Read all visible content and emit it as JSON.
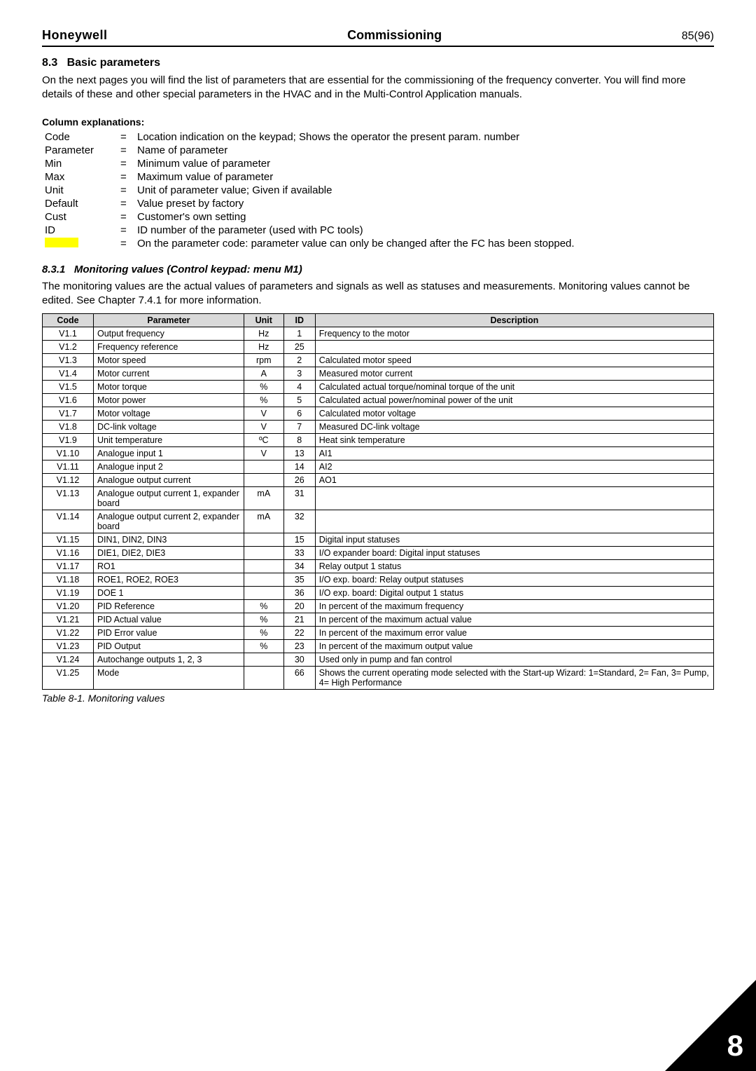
{
  "header": {
    "brand": "Honeywell",
    "title": "Commissioning",
    "page": "85(96)"
  },
  "section": {
    "number": "8.3",
    "title": "Basic parameters",
    "intro": "On the next pages you will find the list of parameters that are essential for the commissioning of the frequency converter. You will find more details of these and other special parameters in the HVAC and in the Multi-Control Application manuals."
  },
  "column_explanations": {
    "heading": "Column explanations:",
    "rows": [
      {
        "label": "Code",
        "desc": "Location indication on the keypad; Shows the operator the present param. number"
      },
      {
        "label": "Parameter",
        "desc": "Name of parameter"
      },
      {
        "label": "Min",
        "desc": "Minimum value of parameter"
      },
      {
        "label": "Max",
        "desc": "Maximum value of parameter"
      },
      {
        "label": "Unit",
        "desc": "Unit of parameter value; Given if available"
      },
      {
        "label": "Default",
        "desc": "Value preset by factory"
      },
      {
        "label": "Cust",
        "desc": "Customer's own setting"
      },
      {
        "label": "ID",
        "desc": "ID number of the parameter (used with PC tools)"
      },
      {
        "label": "__YELLOW__",
        "desc": "On the parameter code: parameter value can only be changed after the FC has been stopped."
      }
    ]
  },
  "subsection": {
    "number": "8.3.1",
    "title": "Monitoring values (Control keypad: menu M1)",
    "intro": "The monitoring values are the actual values of parameters and signals as well as statuses and measurements. Monitoring values cannot be edited. See Chapter 7.4.1 for more information."
  },
  "table": {
    "headers": {
      "code": "Code",
      "parameter": "Parameter",
      "unit": "Unit",
      "id": "ID",
      "description": "Description"
    },
    "rows": [
      {
        "code": "V1.1",
        "parameter": "Output frequency",
        "unit": "Hz",
        "id": "1",
        "description": "Frequency to the motor"
      },
      {
        "code": "V1.2",
        "parameter": "Frequency reference",
        "unit": "Hz",
        "id": "25",
        "description": ""
      },
      {
        "code": "V1.3",
        "parameter": "Motor speed",
        "unit": "rpm",
        "id": "2",
        "description": "Calculated motor speed"
      },
      {
        "code": "V1.4",
        "parameter": "Motor current",
        "unit": "A",
        "id": "3",
        "description": "Measured motor current"
      },
      {
        "code": "V1.5",
        "parameter": "Motor torque",
        "unit": "%",
        "id": "4",
        "description": "Calculated actual torque/nominal torque of the unit"
      },
      {
        "code": "V1.6",
        "parameter": "Motor power",
        "unit": "%",
        "id": "5",
        "description": "Calculated actual power/nominal power of the unit"
      },
      {
        "code": "V1.7",
        "parameter": "Motor voltage",
        "unit": "V",
        "id": "6",
        "description": "Calculated motor voltage"
      },
      {
        "code": "V1.8",
        "parameter": "DC-link voltage",
        "unit": "V",
        "id": "7",
        "description": "Measured DC-link voltage"
      },
      {
        "code": "V1.9",
        "parameter": "Unit temperature",
        "unit": "ºC",
        "id": "8",
        "description": "Heat sink temperature"
      },
      {
        "code": "V1.10",
        "parameter": "Analogue input 1",
        "unit": "V",
        "id": "13",
        "description": "AI1"
      },
      {
        "code": "V1.11",
        "parameter": "Analogue input 2",
        "unit": "",
        "id": "14",
        "description": "AI2"
      },
      {
        "code": "V1.12",
        "parameter": "Analogue output current",
        "unit": "",
        "id": "26",
        "description": "AO1"
      },
      {
        "code": "V1.13",
        "parameter": "Analogue output current 1, expander board",
        "unit": "mA",
        "id": "31",
        "description": ""
      },
      {
        "code": "V1.14",
        "parameter": "Analogue output current 2, expander board",
        "unit": "mA",
        "id": "32",
        "description": ""
      },
      {
        "code": "V1.15",
        "parameter": "DIN1, DIN2, DIN3",
        "unit": "",
        "id": "15",
        "description": "Digital input statuses"
      },
      {
        "code": "V1.16",
        "parameter": "DIE1, DIE2, DIE3",
        "unit": "",
        "id": "33",
        "description": "I/O expander board: Digital input statuses"
      },
      {
        "code": "V1.17",
        "parameter": "RO1",
        "unit": "",
        "id": "34",
        "description": "Relay output 1 status"
      },
      {
        "code": "V1.18",
        "parameter": "ROE1, ROE2, ROE3",
        "unit": "",
        "id": "35",
        "description": "I/O exp. board:  Relay output statuses"
      },
      {
        "code": "V1.19",
        "parameter": "DOE 1",
        "unit": "",
        "id": "36",
        "description": "I/O exp. board: Digital output 1 status"
      },
      {
        "code": "V1.20",
        "parameter": "PID Reference",
        "unit": "%",
        "id": "20",
        "description": "In percent of the maximum frequency"
      },
      {
        "code": "V1.21",
        "parameter": "PID Actual value",
        "unit": "%",
        "id": "21",
        "description": "In percent of the maximum actual value"
      },
      {
        "code": "V1.22",
        "parameter": "PID Error value",
        "unit": "%",
        "id": "22",
        "description": "In percent of the maximum error value"
      },
      {
        "code": "V1.23",
        "parameter": "PID Output",
        "unit": "%",
        "id": "23",
        "description": "In percent of the maximum output value"
      },
      {
        "code": "V1.24",
        "parameter": "Autochange outputs 1, 2, 3",
        "unit": "",
        "id": "30",
        "description": "Used only in pump and fan control"
      },
      {
        "code": "V1.25",
        "parameter": "Mode",
        "unit": "",
        "id": "66",
        "description": "Shows the current operating mode selected with the Start-up Wizard: 1=Standard, 2= Fan, 3= Pump, 4= High Performance"
      }
    ],
    "caption": "Table 8-1. Monitoring values"
  },
  "corner_number": "8"
}
